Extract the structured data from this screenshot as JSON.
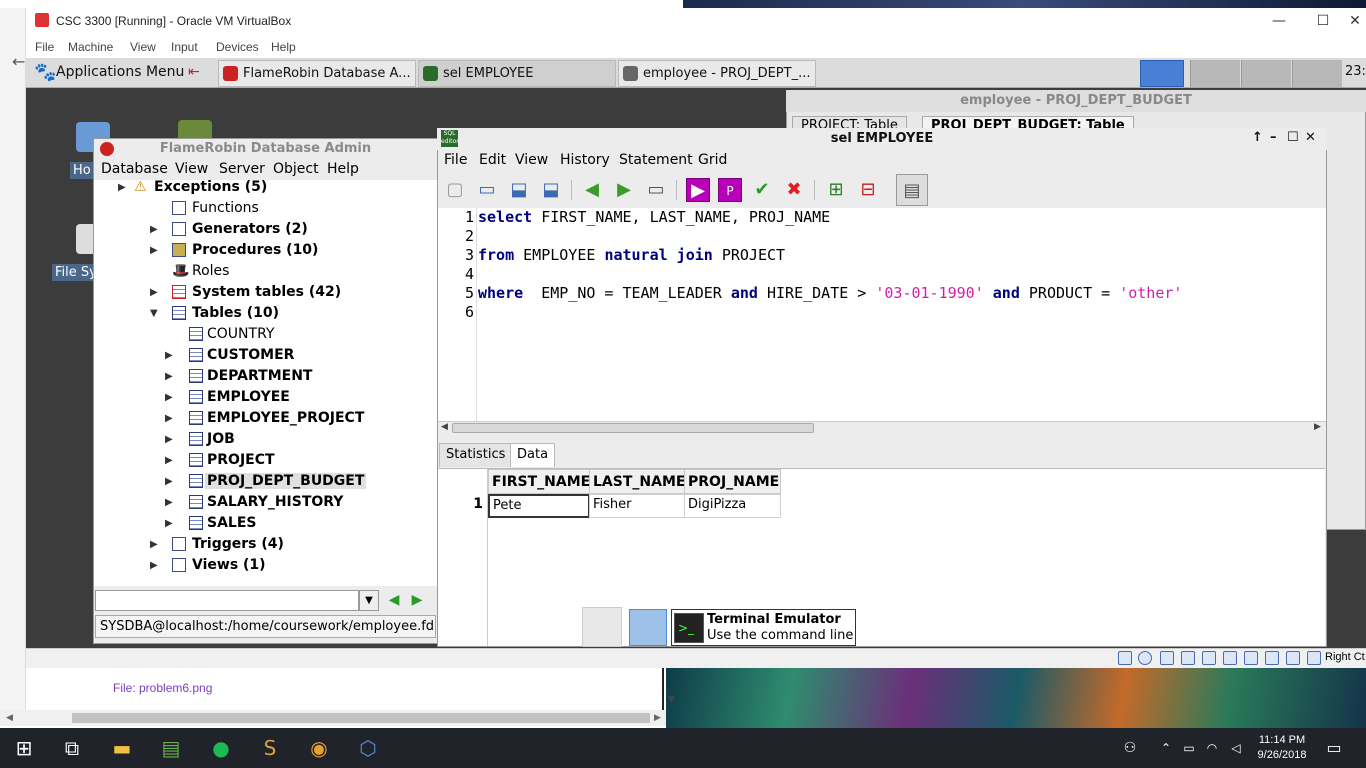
{
  "host": {
    "window_title": "CSC 3300 [Running] - Oracle VM VirtualBox",
    "menu": [
      "File",
      "Machine",
      "View",
      "Input",
      "Devices",
      "Help"
    ],
    "file_label": "File: problem6.png",
    "status_right": "Right Ct",
    "clock_time": "11:14 PM",
    "clock_date": "9/26/2018"
  },
  "guest_panel": {
    "apps_menu": "Applications Menu",
    "tasks": [
      "FlameRobin Database A...",
      "sel EMPLOYEE",
      "employee - PROJ_DEPT_..."
    ],
    "clock": "23:",
    "desktop_icons": [
      "Ho",
      "File Sy"
    ]
  },
  "employee_window": {
    "title": "employee - PROJ_DEPT_BUDGET",
    "tabs": [
      "PROJECT: Table",
      "PROJ_DEPT_BUDGET: Table"
    ]
  },
  "flamerobin": {
    "title": "FlameRobin Database Admin",
    "menu": [
      "Database",
      "View",
      "Server",
      "Object",
      "Help"
    ],
    "tree": [
      {
        "label": "Exceptions (5)",
        "bold": true
      },
      {
        "label": "Functions",
        "bold": false
      },
      {
        "label": "Generators (2)",
        "bold": true
      },
      {
        "label": "Procedures (10)",
        "bold": true
      },
      {
        "label": "Roles",
        "bold": false
      },
      {
        "label": "System tables (42)",
        "bold": true
      },
      {
        "label": "Tables (10)",
        "bold": true
      },
      {
        "label": "COUNTRY",
        "bold": false
      },
      {
        "label": "CUSTOMER",
        "bold": true
      },
      {
        "label": "DEPARTMENT",
        "bold": true
      },
      {
        "label": "EMPLOYEE",
        "bold": true
      },
      {
        "label": "EMPLOYEE_PROJECT",
        "bold": true
      },
      {
        "label": "JOB",
        "bold": true
      },
      {
        "label": "PROJECT",
        "bold": true
      },
      {
        "label": "PROJ_DEPT_BUDGET",
        "bold": true
      },
      {
        "label": "SALARY_HISTORY",
        "bold": true
      },
      {
        "label": "SALES",
        "bold": true
      },
      {
        "label": "Triggers (4)",
        "bold": true
      },
      {
        "label": "Views (1)",
        "bold": true
      }
    ],
    "status": "SYSDBA@localhost:/home/coursework/employee.fdb"
  },
  "sql_editor": {
    "title": "sel EMPLOYEE",
    "logo": "SQL editor",
    "menu": [
      "File",
      "Edit",
      "View",
      "History",
      "Statement",
      "Grid"
    ],
    "line_numbers": [
      "1",
      "2",
      "3",
      "4",
      "5",
      "6"
    ],
    "code": {
      "l1_kw": "select",
      "l1_rest": " FIRST_NAME, LAST_NAME, PROJ_NAME",
      "l3_kw1": "from",
      "l3_mid": " EMPLOYEE ",
      "l3_kw2": "natural join",
      "l3_rest": " PROJECT",
      "l5_kw1": "where",
      "l5_a": "  EMP_NO = TEAM_LEADER ",
      "l5_kw2": "and",
      "l5_b": " HIRE_DATE > ",
      "l5_str1": "'03-01-1990'",
      "l5_c": " ",
      "l5_kw3": "and",
      "l5_d": " PRODUCT = ",
      "l5_str2": "'other'"
    },
    "bottom_tabs": [
      "Statistics",
      "Data"
    ],
    "grid": {
      "columns": [
        "FIRST_NAME",
        "LAST_NAME",
        "PROJ_NAME"
      ],
      "row_number": "1",
      "row": [
        "Pete",
        "Fisher",
        "DigiPizza"
      ]
    }
  },
  "tooltip": {
    "name": "Terminal Emulator",
    "description": "Use the command line"
  }
}
